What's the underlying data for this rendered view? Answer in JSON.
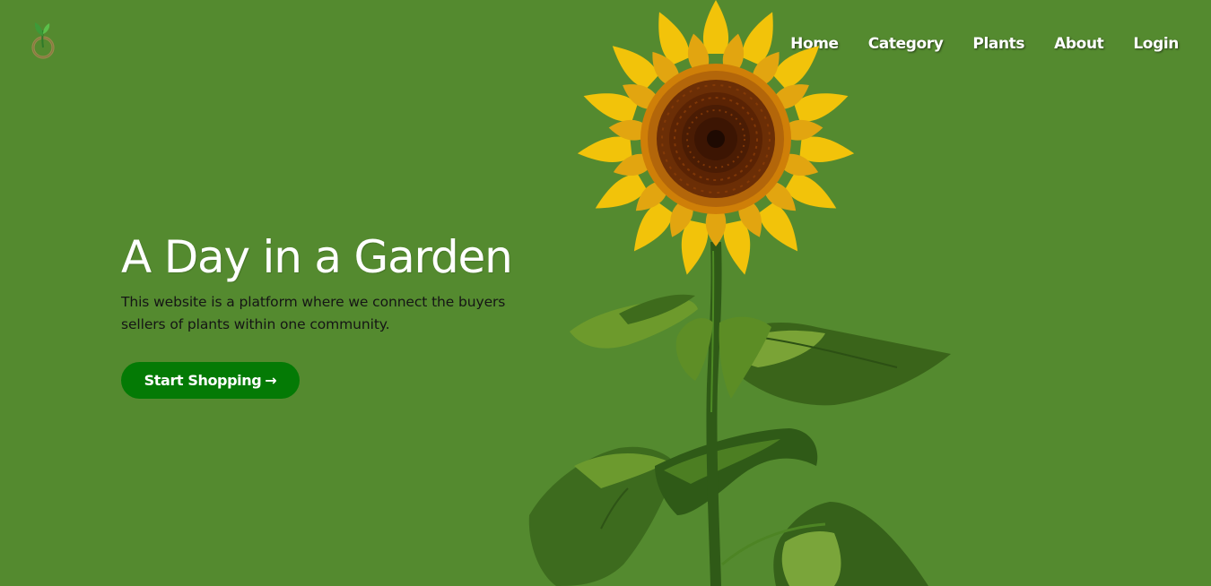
{
  "logo": {
    "icon": "sprout-logo-icon"
  },
  "nav": {
    "items": [
      {
        "label": "Home"
      },
      {
        "label": "Category"
      },
      {
        "label": "Plants"
      },
      {
        "label": "About"
      },
      {
        "label": "Login"
      }
    ]
  },
  "hero": {
    "title": "A Day in a Garden",
    "description": "This website is a platform where we connect the buyers sellers of plants within one community.",
    "cta_label": "Start Shopping",
    "cta_arrow": "→"
  },
  "illustration": {
    "icon": "sunflower-illustration"
  },
  "colors": {
    "background": "#548a2f",
    "button": "#047a05",
    "petal": "#f2c30a",
    "seed_center": "#4a1e05"
  }
}
